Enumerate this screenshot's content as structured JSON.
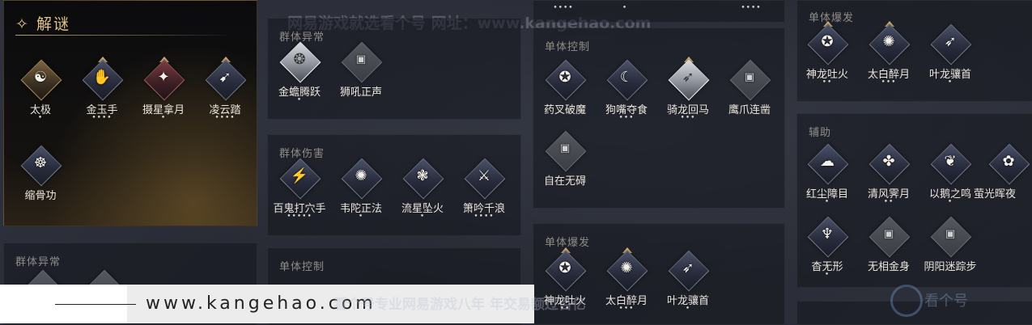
{
  "watermarks": {
    "top": "网易游戏就选看个号  网址：www.kangehao.com",
    "bottom": "看个号专业网易游戏八年 年交易额过百亿",
    "banner_url": "www.kangehao.com",
    "corner_logo": "看个号"
  },
  "puzzle": {
    "title": "✧ 解谜",
    "skills": [
      {
        "name": "太极",
        "dots": "•",
        "glyph": "☯"
      },
      {
        "name": "金玉手",
        "dots": "••••",
        "glyph": "✋"
      },
      {
        "name": "摄星拿月",
        "dots": "•",
        "glyph": "✦"
      },
      {
        "name": "凌云踏",
        "dots": "••••",
        "glyph": "➹"
      },
      {
        "name": "缩骨功",
        "dots": "",
        "glyph": "☸"
      }
    ]
  },
  "col2": {
    "group_debuff": {
      "title": "群体异常",
      "skills": [
        {
          "name": "金蟾腾跃",
          "dots": "•",
          "glyph": "❂"
        },
        {
          "name": "狮吼正声",
          "dots": "",
          "glyph": "▣"
        }
      ]
    },
    "group_damage": {
      "title": "群体伤害",
      "skills": [
        {
          "name": "百鬼打穴手",
          "dots": "•••••",
          "glyph": "⚡"
        },
        {
          "name": "韦陀正法",
          "dots": "•",
          "glyph": "✺"
        },
        {
          "name": "流星坠火",
          "dots": "•",
          "glyph": "❃"
        },
        {
          "name": "箫吟千浪",
          "dots": "••••",
          "glyph": "⚔"
        }
      ]
    },
    "group_control": {
      "title": "单体控制"
    }
  },
  "col1_bottom": {
    "title": "群体异常"
  },
  "col3": {
    "top_dots": [
      "••••",
      "•",
      "••••"
    ],
    "single_control": {
      "title": "单体控制",
      "skills": [
        {
          "name": "药叉破魔",
          "dots": "",
          "glyph": "✪"
        },
        {
          "name": "狗嘴夺食",
          "dots": "•••",
          "glyph": "☾"
        },
        {
          "name": "骑龙回马",
          "dots": "•••",
          "glyph": "➶"
        },
        {
          "name": "鹰爪连凿",
          "dots": "",
          "glyph": "▣"
        },
        {
          "name": "自在无碍",
          "dots": "",
          "glyph": "▣"
        }
      ]
    },
    "single_burst": {
      "title": "单体爆发",
      "skills": [
        {
          "name": "神龙吐火",
          "dots": "••",
          "glyph": "✪"
        },
        {
          "name": "太白醉月",
          "dots": "•••",
          "glyph": "✺"
        },
        {
          "name": "叶龙骧首",
          "dots": "•",
          "glyph": "➶"
        }
      ]
    }
  },
  "col4": {
    "single_burst": {
      "title": "单体爆发",
      "skills": [
        {
          "name": "神龙吐火",
          "dots": "••",
          "glyph": "✪"
        },
        {
          "name": "太白醉月",
          "dots": "•••",
          "glyph": "✺"
        },
        {
          "name": "叶龙骧首",
          "dots": "•",
          "glyph": "➶"
        }
      ]
    },
    "support": {
      "title": "辅助",
      "skills": [
        {
          "name": "红尘障目",
          "dots": "•",
          "glyph": "☁"
        },
        {
          "name": "清风霁月",
          "dots": "••",
          "glyph": "✤"
        },
        {
          "name": "以鹅之鸣",
          "dots": "•",
          "glyph": "❦"
        },
        {
          "name": "萤光晖夜",
          "dots": "",
          "glyph": "✿"
        },
        {
          "name": "杳无形",
          "dots": "•",
          "glyph": "♆"
        },
        {
          "name": "无相金身",
          "dots": "",
          "glyph": "▣"
        },
        {
          "name": "阴阳迷踪步",
          "dots": "",
          "glyph": "▣"
        }
      ]
    }
  }
}
